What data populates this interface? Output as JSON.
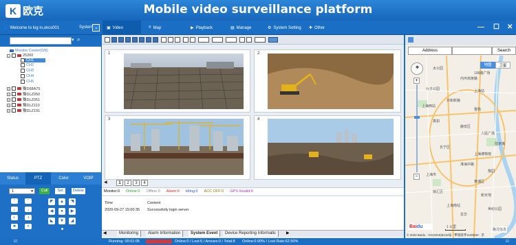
{
  "header": {
    "logo_letter": "K",
    "logo_text": "欧克",
    "title": "Mobile video surveillance platform",
    "window_controls": [
      "—",
      "☐",
      "✕"
    ]
  },
  "nav": {
    "welcome": "Welcome to log in,okcs001",
    "system_label": "System",
    "tabs": [
      {
        "label": "Video",
        "icon": "video-icon"
      },
      {
        "label": "Map",
        "icon": "map-pin-icon"
      },
      {
        "label": "Playback",
        "icon": "playback-icon"
      },
      {
        "label": "Manage",
        "icon": "manage-icon"
      },
      {
        "label": "System Setting",
        "icon": "gear-icon"
      },
      {
        "label": "Other",
        "icon": "other-icon"
      }
    ]
  },
  "tree": {
    "root": "Monitor Center(0/8)",
    "group": "25260",
    "channels": [
      "CH1",
      "CH2",
      "CH3",
      "CH4",
      "CH5"
    ],
    "vehicles": [
      "豫D68A75",
      "豫DLZ050",
      "豫DLZ051",
      "豫DLZ110",
      "豫DLZ191"
    ]
  },
  "control_tabs": [
    "Status",
    "PTZ",
    "Color",
    "VOIP"
  ],
  "ptz": {
    "speed_value": "1",
    "call_label": "Call",
    "set_label": "Set",
    "delete_label": "Delete"
  },
  "video": {
    "cells": [
      "1",
      "2",
      "3",
      "4"
    ],
    "pages": [
      "1",
      "2",
      "3",
      "4"
    ]
  },
  "monitor_stats": {
    "monitor": "Monitor:0",
    "online": "Online:0",
    "offline": "Offline:0",
    "alarm": "Alarm:0",
    "idling": "Idling:0",
    "acc_off": "ACC OFF:0",
    "gps_invalid": "GPS Invalid:0",
    "colors": {
      "online": "#2a9d2a",
      "offline": "#888888",
      "alarm": "#d22",
      "idling": "#3355cc",
      "acc_off": "#8a7a00",
      "gps_invalid": "#b030b0"
    }
  },
  "log": {
    "headers": [
      "Time",
      "Content"
    ],
    "rows": [
      [
        "2020-09-27 15:00:35",
        "Successfully login server"
      ]
    ]
  },
  "bottom_tabs": [
    "Monitoring",
    "Alarm Information",
    "System Event",
    "Device Reporting Informatic"
  ],
  "map": {
    "address_label": "Address",
    "search_label": "Search",
    "type_map": "地图",
    "type_satellite": "卫星",
    "labels": [
      "太公园",
      "上海市",
      "上海西站",
      "真如",
      "108路广场",
      "内环高架路",
      "上海站",
      "九子公园",
      "共和新路",
      "黄浦区",
      "上海博物馆",
      "豫园",
      "徐汇区",
      "长宁区",
      "静安区",
      "淮海中路",
      "上海南站",
      "龙华",
      "曹杨",
      "陆家嘴",
      "人民广场",
      "世纪公园",
      "新天地"
    ],
    "scale": "1 公里",
    "traffic": "路况信息",
    "copyright": "© 2020 Baidu - GS(2019)5218号 - 甲测资字1100930 - 京"
  },
  "status": {
    "running": "Running: 00:01:05",
    "summary": "Online:0 / Lost:5 / Arrears:0 / Total:8",
    "online_rate": "Online:0.00% / Lost Rate:62.50%"
  }
}
